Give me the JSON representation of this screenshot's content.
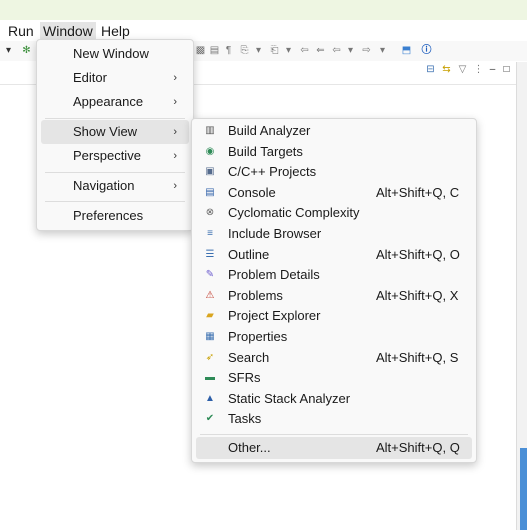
{
  "menubar": {
    "run": "Run",
    "window": "Window",
    "help": "Help"
  },
  "window_menu": {
    "new_window": "New Window",
    "editor": "Editor",
    "appearance": "Appearance",
    "show_view": "Show View",
    "perspective": "Perspective",
    "navigation": "Navigation",
    "preferences": "Preferences",
    "submenu_arrow": "›"
  },
  "show_view": {
    "items": [
      {
        "label": "Build Analyzer",
        "shortcut": "",
        "icon": "bar-chart-icon",
        "glyph": "▥",
        "color": "#555555"
      },
      {
        "label": "Build Targets",
        "shortcut": "",
        "icon": "target-icon",
        "glyph": "◉",
        "color": "#2e8b57"
      },
      {
        "label": "C/C++ Projects",
        "shortcut": "",
        "icon": "projects-icon",
        "glyph": "▣",
        "color": "#556b8d"
      },
      {
        "label": "Console",
        "shortcut": "Alt+Shift+Q, C",
        "icon": "console-icon",
        "glyph": "▤",
        "color": "#2d5fa8"
      },
      {
        "label": "Cyclomatic Complexity",
        "shortcut": "",
        "icon": "complexity-icon",
        "glyph": "⊗",
        "color": "#666666"
      },
      {
        "label": "Include Browser",
        "shortcut": "",
        "icon": "include-icon",
        "glyph": "≡",
        "color": "#3a6fb0"
      },
      {
        "label": "Outline",
        "shortcut": "Alt+Shift+Q, O",
        "icon": "outline-icon",
        "glyph": "☰",
        "color": "#3a6fb0"
      },
      {
        "label": "Problem Details",
        "shortcut": "",
        "icon": "problem-details-icon",
        "glyph": "✎",
        "color": "#6a5acd"
      },
      {
        "label": "Problems",
        "shortcut": "Alt+Shift+Q, X",
        "icon": "problems-icon",
        "glyph": "⚠",
        "color": "#c0392b"
      },
      {
        "label": "Project Explorer",
        "shortcut": "",
        "icon": "folder-icon",
        "glyph": "▰",
        "color": "#d9a520"
      },
      {
        "label": "Properties",
        "shortcut": "",
        "icon": "properties-icon",
        "glyph": "▦",
        "color": "#3a6fb0"
      },
      {
        "label": "Search",
        "shortcut": "Alt+Shift+Q, S",
        "icon": "search-icon",
        "glyph": "➶",
        "color": "#c8a000"
      },
      {
        "label": "SFRs",
        "shortcut": "",
        "icon": "sfr-icon",
        "glyph": "▬",
        "color": "#2e8b57"
      },
      {
        "label": "Static Stack Analyzer",
        "shortcut": "",
        "icon": "stack-icon",
        "glyph": "▲",
        "color": "#2d5fa8"
      },
      {
        "label": "Tasks",
        "shortcut": "",
        "icon": "tasks-icon",
        "glyph": "✔",
        "color": "#2e8b57"
      }
    ],
    "other": {
      "label": "Other...",
      "shortcut": "Alt+Shift+Q, Q"
    }
  }
}
